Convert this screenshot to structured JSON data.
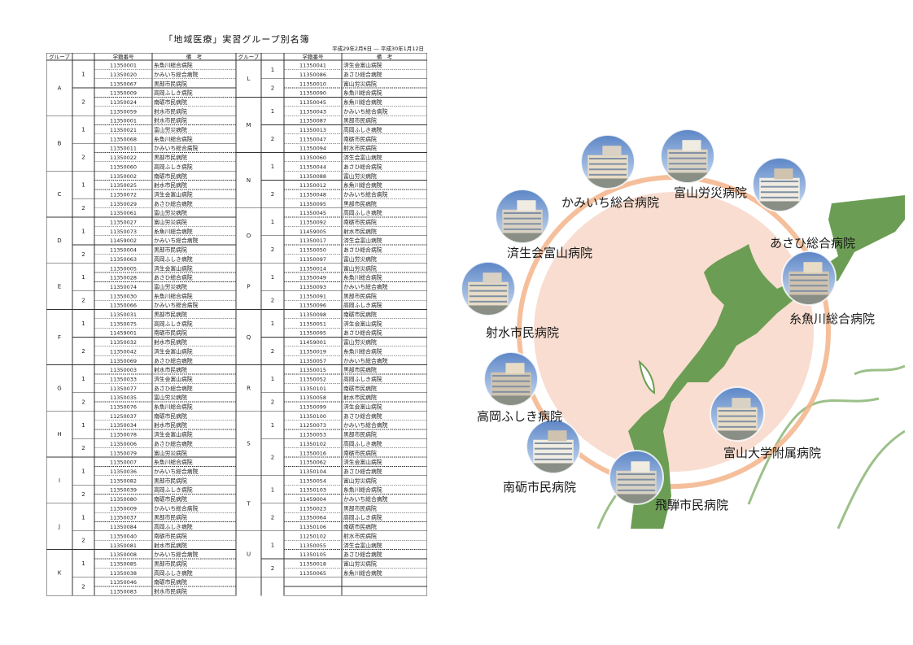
{
  "roster": {
    "title": "「地域医療」実習グループ別名簿",
    "period": "平成29年2月6日 ― 平成30年1月12日",
    "headers": {
      "group": "グループ",
      "student_id": "学籍番号",
      "note": "備　考"
    },
    "left_rows": [
      {
        "group": "A",
        "sub": "1",
        "id": "11350001",
        "note": "糸魚川総合病院"
      },
      {
        "group": "",
        "sub": "",
        "id": "11350020",
        "note": "かみいち総合病院"
      },
      {
        "group": "",
        "sub": "",
        "id": "11350067",
        "note": "黒部市民病院"
      },
      {
        "group": "",
        "sub": "2",
        "id": "11350009",
        "note": "高岡ふしき病院"
      },
      {
        "group": "",
        "sub": "",
        "id": "11350024",
        "note": "南砺市民病院"
      },
      {
        "group": "",
        "sub": "",
        "id": "11350059",
        "note": "射水市民病院"
      },
      {
        "group": "B",
        "sub": "1",
        "id": "11350001",
        "note": "射水市民病院"
      },
      {
        "group": "",
        "sub": "",
        "id": "11350021",
        "note": "富山労災病院"
      },
      {
        "group": "",
        "sub": "",
        "id": "11350068",
        "note": "糸魚川総合病院"
      },
      {
        "group": "",
        "sub": "2",
        "id": "11350011",
        "note": "かみいち総合病院"
      },
      {
        "group": "",
        "sub": "",
        "id": "11350022",
        "note": "黒部市民病院"
      },
      {
        "group": "",
        "sub": "",
        "id": "11350060",
        "note": "高岡ふしき病院"
      },
      {
        "group": "C",
        "sub": "1",
        "id": "11350002",
        "note": "南砺市民病院"
      },
      {
        "group": "",
        "sub": "",
        "id": "11350025",
        "note": "射水市民病院"
      },
      {
        "group": "",
        "sub": "",
        "id": "11350072",
        "note": "済生会富山病院"
      },
      {
        "group": "",
        "sub": "2",
        "id": "11350029",
        "note": "あさひ総合病院"
      },
      {
        "group": "",
        "sub": "",
        "id": "11350061",
        "note": "富山労災病院"
      },
      {
        "group": "D",
        "sub": "1",
        "id": "11350027",
        "note": "富山労災病院"
      },
      {
        "group": "",
        "sub": "",
        "id": "11350073",
        "note": "糸魚川総合病院"
      },
      {
        "group": "",
        "sub": "",
        "id": "11459002",
        "note": "かみいち総合病院"
      },
      {
        "group": "",
        "sub": "2",
        "id": "11350004",
        "note": "黒部市民病院"
      },
      {
        "group": "",
        "sub": "",
        "id": "11350063",
        "note": "高岡ふしき病院"
      },
      {
        "group": "E",
        "sub": "1",
        "id": "11350005",
        "note": "済生会富山病院"
      },
      {
        "group": "",
        "sub": "",
        "id": "11350028",
        "note": "あさひ総合病院"
      },
      {
        "group": "",
        "sub": "",
        "id": "11350074",
        "note": "富山労災病院"
      },
      {
        "group": "",
        "sub": "2",
        "id": "11350030",
        "note": "糸魚川総合病院"
      },
      {
        "group": "",
        "sub": "",
        "id": "11350066",
        "note": "かみいち総合病院"
      },
      {
        "group": "F",
        "sub": "1",
        "id": "11350031",
        "note": "黒部市民病院"
      },
      {
        "group": "",
        "sub": "",
        "id": "11350075",
        "note": "高岡ふしき病院"
      },
      {
        "group": "",
        "sub": "",
        "id": "11459001",
        "note": "南砺市民病院"
      },
      {
        "group": "",
        "sub": "2",
        "id": "11350032",
        "note": "射水市民病院"
      },
      {
        "group": "",
        "sub": "",
        "id": "11350042",
        "note": "済生会富山病院"
      },
      {
        "group": "",
        "sub": "",
        "id": "11350069",
        "note": "あさひ総合病院"
      },
      {
        "group": "G",
        "sub": "1",
        "id": "11350003",
        "note": "射水市民病院"
      },
      {
        "group": "",
        "sub": "",
        "id": "11350033",
        "note": "済生会富山病院"
      },
      {
        "group": "",
        "sub": "",
        "id": "11350077",
        "note": "あさひ総合病院"
      },
      {
        "group": "",
        "sub": "2",
        "id": "11350035",
        "note": "富山労災病院"
      },
      {
        "group": "",
        "sub": "",
        "id": "11350076",
        "note": "糸魚川総合病院"
      },
      {
        "group": "H",
        "sub": "1",
        "id": "11250037",
        "note": "南砺市民病院"
      },
      {
        "group": "",
        "sub": "",
        "id": "11350034",
        "note": "射水市民病院"
      },
      {
        "group": "",
        "sub": "",
        "id": "11350078",
        "note": "済生会富山病院"
      },
      {
        "group": "",
        "sub": "2",
        "id": "11350006",
        "note": "あさひ総合病院"
      },
      {
        "group": "",
        "sub": "",
        "id": "11350079",
        "note": "富山労災病院"
      },
      {
        "group": "I",
        "sub": "1",
        "id": "11350007",
        "note": "糸魚川総合病院"
      },
      {
        "group": "",
        "sub": "",
        "id": "11350036",
        "note": "かみいち総合病院"
      },
      {
        "group": "",
        "sub": "",
        "id": "11350082",
        "note": "黒部市民病院"
      },
      {
        "group": "",
        "sub": "2",
        "id": "11350039",
        "note": "高岡ふしき病院"
      },
      {
        "group": "",
        "sub": "",
        "id": "11350080",
        "note": "南砺市民病院"
      },
      {
        "group": "J",
        "sub": "1",
        "id": "11350009",
        "note": "かみいち総合病院"
      },
      {
        "group": "",
        "sub": "",
        "id": "11350037",
        "note": "黒部市民病院"
      },
      {
        "group": "",
        "sub": "",
        "id": "11350084",
        "note": "高岡ふしき病院"
      },
      {
        "group": "",
        "sub": "2",
        "id": "11350040",
        "note": "南砺市民病院"
      },
      {
        "group": "",
        "sub": "",
        "id": "11350081",
        "note": "射水市民病院"
      },
      {
        "group": "K",
        "sub": "1",
        "id": "11350008",
        "note": "かみいち総合病院"
      },
      {
        "group": "",
        "sub": "",
        "id": "11350085",
        "note": "黒部市民病院"
      },
      {
        "group": "",
        "sub": "",
        "id": "11350038",
        "note": "高岡ふしき病院"
      },
      {
        "group": "",
        "sub": "2",
        "id": "11350046",
        "note": "南砺市民病院"
      },
      {
        "group": "",
        "sub": "",
        "id": "11350083",
        "note": "射水市民病院"
      }
    ],
    "right_rows": [
      {
        "group": "L",
        "sub": "1",
        "id": "11350041",
        "note": "済生会富山病院"
      },
      {
        "group": "",
        "sub": "",
        "id": "11350086",
        "note": "あさひ総合病院"
      },
      {
        "group": "",
        "sub": "2",
        "id": "11350010",
        "note": "富山労災病院"
      },
      {
        "group": "",
        "sub": "",
        "id": "11350090",
        "note": "糸魚川総合病院"
      },
      {
        "group": "M",
        "sub": "1",
        "id": "11350045",
        "note": "糸魚川総合病院"
      },
      {
        "group": "",
        "sub": "",
        "id": "11350043",
        "note": "かみいち総合病院"
      },
      {
        "group": "",
        "sub": "",
        "id": "11350087",
        "note": "黒部市民病院"
      },
      {
        "group": "",
        "sub": "2",
        "id": "11350013",
        "note": "高岡ふしき病院"
      },
      {
        "group": "",
        "sub": "",
        "id": "11350047",
        "note": "南砺市民病院"
      },
      {
        "group": "",
        "sub": "",
        "id": "11350094",
        "note": "射水市民病院"
      },
      {
        "group": "N",
        "sub": "1",
        "id": "11350060",
        "note": "済生会富山病院"
      },
      {
        "group": "",
        "sub": "",
        "id": "11350044",
        "note": "あさひ総合病院"
      },
      {
        "group": "",
        "sub": "",
        "id": "11350088",
        "note": "富山労災病院"
      },
      {
        "group": "",
        "sub": "2",
        "id": "11350012",
        "note": "糸魚川総合病院"
      },
      {
        "group": "",
        "sub": "",
        "id": "11350048",
        "note": "かみいち総合病院"
      },
      {
        "group": "",
        "sub": "",
        "id": "11350095",
        "note": "黒部市民病院"
      },
      {
        "group": "O",
        "sub": "1",
        "id": "11350045",
        "note": "高岡ふしき病院"
      },
      {
        "group": "",
        "sub": "",
        "id": "11350092",
        "note": "南砺市民病院"
      },
      {
        "group": "",
        "sub": "",
        "id": "11459005",
        "note": "射水市民病院"
      },
      {
        "group": "",
        "sub": "2",
        "id": "11350017",
        "note": "済生会富山病院"
      },
      {
        "group": "",
        "sub": "",
        "id": "11350050",
        "note": "あさひ総合病院"
      },
      {
        "group": "",
        "sub": "",
        "id": "11350097",
        "note": "富山労災病院"
      },
      {
        "group": "P",
        "sub": "1",
        "id": "11350014",
        "note": "富山労災病院"
      },
      {
        "group": "",
        "sub": "",
        "id": "11350049",
        "note": "糸魚川総合病院"
      },
      {
        "group": "",
        "sub": "",
        "id": "11350093",
        "note": "かみいち総合病院"
      },
      {
        "group": "",
        "sub": "2",
        "id": "11350091",
        "note": "黒部市民病院"
      },
      {
        "group": "",
        "sub": "",
        "id": "11350096",
        "note": "高岡ふしき病院"
      },
      {
        "group": "Q",
        "sub": "1",
        "id": "11350098",
        "note": "南砺市民病院"
      },
      {
        "group": "",
        "sub": "",
        "id": "11350051",
        "note": "済生会富山病院"
      },
      {
        "group": "",
        "sub": "",
        "id": "11350095",
        "note": "あさひ総合病院"
      },
      {
        "group": "",
        "sub": "2",
        "id": "11459001",
        "note": "富山労災病院"
      },
      {
        "group": "",
        "sub": "",
        "id": "11350019",
        "note": "糸魚川総合病院"
      },
      {
        "group": "",
        "sub": "",
        "id": "11350057",
        "note": "かみいち総合病院"
      },
      {
        "group": "R",
        "sub": "1",
        "id": "11350015",
        "note": "黒部市民病院"
      },
      {
        "group": "",
        "sub": "",
        "id": "11350052",
        "note": "高岡ふしき病院"
      },
      {
        "group": "",
        "sub": "",
        "id": "11350101",
        "note": "南砺市民病院"
      },
      {
        "group": "",
        "sub": "2",
        "id": "11350058",
        "note": "射水市民病院"
      },
      {
        "group": "",
        "sub": "",
        "id": "11350099",
        "note": "済生会富山病院"
      },
      {
        "group": "S",
        "sub": "1",
        "id": "11350100",
        "note": "あさひ総合病院"
      },
      {
        "group": "",
        "sub": "",
        "id": "11250073",
        "note": "かみいち総合病院"
      },
      {
        "group": "",
        "sub": "",
        "id": "11350053",
        "note": "黒部市民病院"
      },
      {
        "group": "",
        "sub": "2",
        "id": "11350102",
        "note": "高岡ふしき病院"
      },
      {
        "group": "",
        "sub": "",
        "id": "11350016",
        "note": "南砺市民病院"
      },
      {
        "group": "",
        "sub": "",
        "id": "11350062",
        "note": "済生会富山病院"
      },
      {
        "group": "",
        "sub": "",
        "id": "11350104",
        "note": "あさひ総合病院"
      },
      {
        "group": "T",
        "sub": "1",
        "id": "11350054",
        "note": "富山労災病院"
      },
      {
        "group": "",
        "sub": "",
        "id": "11350103",
        "note": "糸魚川総合病院"
      },
      {
        "group": "",
        "sub": "",
        "id": "11459004",
        "note": "かみいち総合病院"
      },
      {
        "group": "",
        "sub": "2",
        "id": "11350023",
        "note": "黒部市民病院"
      },
      {
        "group": "",
        "sub": "",
        "id": "11350064",
        "note": "高岡ふしき病院"
      },
      {
        "group": "",
        "sub": "",
        "id": "11350106",
        "note": "南砺市民病院"
      },
      {
        "group": "U",
        "sub": "1",
        "id": "11250102",
        "note": "射水市民病院"
      },
      {
        "group": "",
        "sub": "",
        "id": "11350055",
        "note": "済生会富山病院"
      },
      {
        "group": "",
        "sub": "",
        "id": "11350105",
        "note": "あさひ総合病院"
      },
      {
        "group": "",
        "sub": "2",
        "id": "11350018",
        "note": "富山労災病院"
      },
      {
        "group": "",
        "sub": "",
        "id": "11350065",
        "note": "糸魚川総合病院"
      }
    ]
  },
  "hospital_map": {
    "hospitals": [
      {
        "name": "かみいち総合病院"
      },
      {
        "name": "富山労災病院"
      },
      {
        "name": "あさひ総合病院"
      },
      {
        "name": "糸魚川総合病院"
      },
      {
        "name": "富山大学附属病院"
      },
      {
        "name": "飛騨市民病院"
      },
      {
        "name": "南砺市民病院"
      },
      {
        "name": "高岡ふしき病院"
      },
      {
        "name": "射水市民病院"
      },
      {
        "name": "済生会富山病院"
      }
    ],
    "colors": {
      "circle_fill": "#f8ddd0",
      "ring": "#f0a070",
      "land": "#6b9e54",
      "outline": "#88b070"
    }
  }
}
